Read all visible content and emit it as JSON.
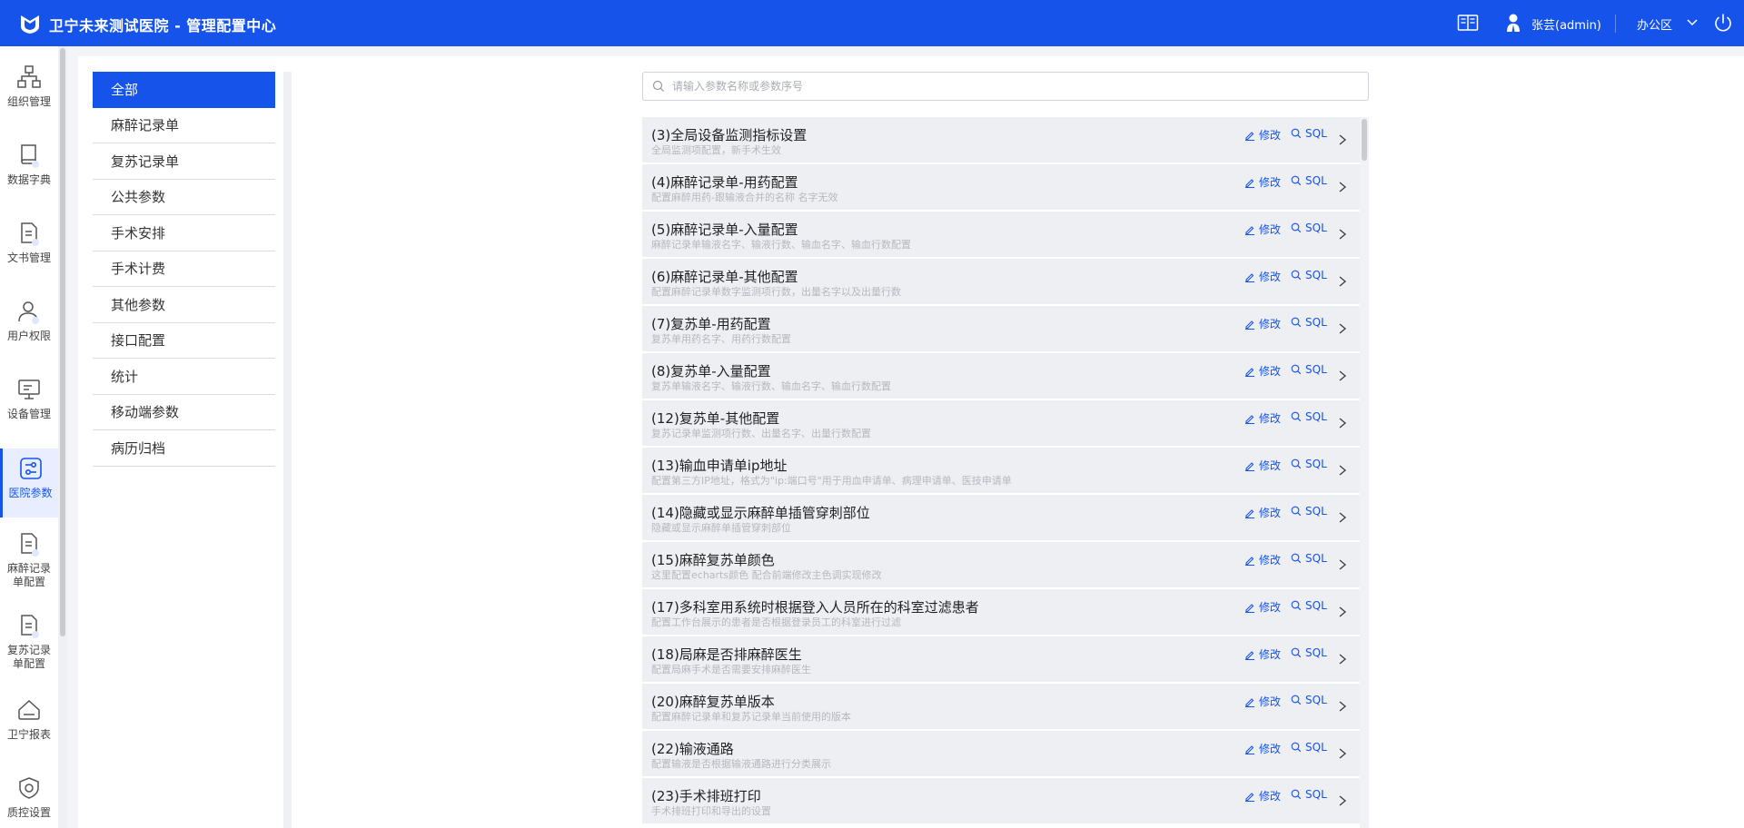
{
  "header": {
    "title": "卫宁未来测试医院 - 管理配置中心",
    "user": "张芸(admin)",
    "area": "办公区",
    "background_color": "#1553ea"
  },
  "rail": {
    "items": [
      {
        "label": "组织管理",
        "icon": "org-chart-icon"
      },
      {
        "label": "数据字典",
        "icon": "book-icon"
      },
      {
        "label": "文书管理",
        "icon": "document-icon"
      },
      {
        "label": "用户权限",
        "icon": "user-icon"
      },
      {
        "label": "设备管理",
        "icon": "monitor-icon"
      },
      {
        "label": "医院参数",
        "icon": "sliders-icon",
        "active": true
      },
      {
        "label": "麻醉记录单配置",
        "icon": "document-icon"
      },
      {
        "label": "复苏记录单配置",
        "icon": "document-icon"
      },
      {
        "label": "卫宁报表",
        "icon": "home-icon"
      },
      {
        "label": "质控设置",
        "icon": "shield-icon"
      }
    ]
  },
  "categories": [
    {
      "label": "全部",
      "active": true
    },
    {
      "label": "麻醉记录单"
    },
    {
      "label": "复苏记录单"
    },
    {
      "label": "公共参数"
    },
    {
      "label": "手术安排"
    },
    {
      "label": "手术计费"
    },
    {
      "label": "其他参数"
    },
    {
      "label": "接口配置"
    },
    {
      "label": "统计"
    },
    {
      "label": "移动端参数"
    },
    {
      "label": "病历归档"
    }
  ],
  "search": {
    "placeholder": "请输入参数名称或参数序号"
  },
  "actions": {
    "edit_label": "修改",
    "sql_label": "SQL"
  },
  "params": [
    {
      "title": "(3)全局设备监测指标设置",
      "desc": "全局监测项配置，新手术生效"
    },
    {
      "title": "(4)麻醉记录单-用药配置",
      "desc": "配置麻醉用药-跟输液合并的名称 名字无效"
    },
    {
      "title": "(5)麻醉记录单-入量配置",
      "desc": "麻醉记录单输液名字、输液行数、输血名字、输血行数配置"
    },
    {
      "title": "(6)麻醉记录单-其他配置",
      "desc": "配置麻醉记录单数字监测项行数，出量名字以及出量行数"
    },
    {
      "title": "(7)复苏单-用药配置",
      "desc": "复苏单用药名字、用药行数配置"
    },
    {
      "title": "(8)复苏单-入量配置",
      "desc": "复苏单输液名字、输液行数、输血名字、输血行数配置"
    },
    {
      "title": "(12)复苏单-其他配置",
      "desc": "复苏记录单监测项行数、出量名字、出量行数配置"
    },
    {
      "title": "(13)输血申请单ip地址",
      "desc": "配置第三方IP地址，格式为\"ip:端口号\"用于用血申请单、病理申请单、医技申请单"
    },
    {
      "title": "(14)隐藏或显示麻醉单插管穿刺部位",
      "desc": "隐藏或显示麻醉单插管穿刺部位"
    },
    {
      "title": "(15)麻醉复苏单颜色",
      "desc": "这里配置echarts颜色 配合前端修改主色调实现修改"
    },
    {
      "title": "(17)多科室用系统时根据登入人员所在的科室过滤患者",
      "desc": "配置工作台展示的患者是否根据登录员工的科室进行过滤"
    },
    {
      "title": "(18)局麻是否排麻醉医生",
      "desc": "配置局麻手术是否需要安排麻醉医生"
    },
    {
      "title": "(20)麻醉复苏单版本",
      "desc": "配置麻醉记录单和复苏记录单当前使用的版本"
    },
    {
      "title": "(22)输液通路",
      "desc": "配置输液是否根据输液通路进行分类展示"
    },
    {
      "title": "(23)手术排班打印",
      "desc": "手术排班打印和导出的设置"
    }
  ]
}
